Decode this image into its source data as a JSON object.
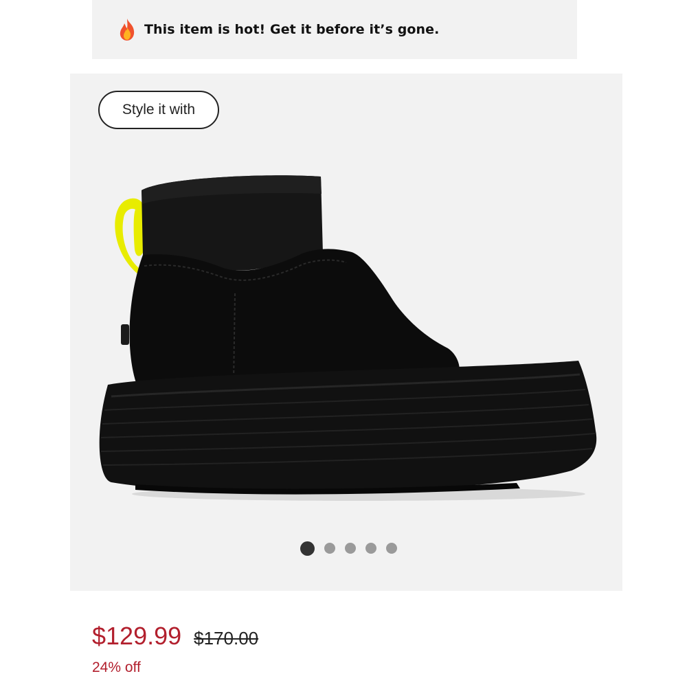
{
  "banner": {
    "message": "This item is hot! Get it before it’s gone.",
    "icon": "fire-icon"
  },
  "gallery": {
    "style_button_label": "Style it with",
    "image_description_icon": "boot-product-image",
    "slide_count": 5,
    "active_slide": 1
  },
  "pricing": {
    "current_price": "$129.99",
    "original_price": "$170.00",
    "discount": "24% off",
    "sale_color": "#b21f2d"
  }
}
